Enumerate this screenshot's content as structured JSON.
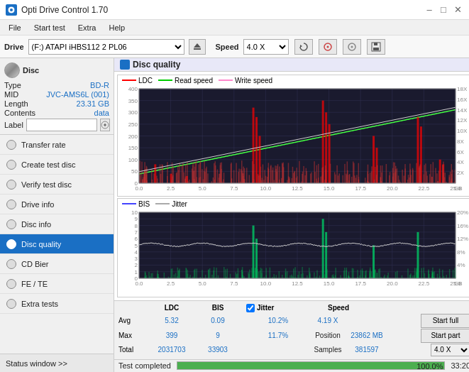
{
  "titlebar": {
    "title": "Opti Drive Control 1.70",
    "min_label": "–",
    "max_label": "□",
    "close_label": "✕"
  },
  "menubar": {
    "items": [
      "File",
      "Start test",
      "Extra",
      "Help"
    ]
  },
  "drivebar": {
    "drive_label": "Drive",
    "drive_value": "(F:)  ATAPI iHBS112  2 PL06",
    "speed_label": "Speed",
    "speed_value": "4.0 X"
  },
  "disc": {
    "label": "Disc",
    "type_label": "Type",
    "type_value": "BD-R",
    "mid_label": "MID",
    "mid_value": "JVC-AMS6L (001)",
    "length_label": "Length",
    "length_value": "23.31 GB",
    "contents_label": "Contents",
    "contents_value": "data",
    "label_label": "Label",
    "label_placeholder": ""
  },
  "nav": {
    "items": [
      {
        "id": "transfer-rate",
        "label": "Transfer rate",
        "active": false
      },
      {
        "id": "create-test-disc",
        "label": "Create test disc",
        "active": false
      },
      {
        "id": "verify-test-disc",
        "label": "Verify test disc",
        "active": false
      },
      {
        "id": "drive-info",
        "label": "Drive info",
        "active": false
      },
      {
        "id": "disc-info",
        "label": "Disc info",
        "active": false
      },
      {
        "id": "disc-quality",
        "label": "Disc quality",
        "active": true
      },
      {
        "id": "cd-bier",
        "label": "CD Bier",
        "active": false
      },
      {
        "id": "fe-te",
        "label": "FE / TE",
        "active": false
      },
      {
        "id": "extra-tests",
        "label": "Extra tests",
        "active": false
      }
    ]
  },
  "status_window": {
    "label": "Status window >>"
  },
  "chart": {
    "title": "Disc quality",
    "legend_top": [
      {
        "label": "LDC",
        "color": "red"
      },
      {
        "label": "Read speed",
        "color": "green"
      },
      {
        "label": "Write speed",
        "color": "pink"
      }
    ],
    "legend_bottom": [
      {
        "label": "BIS",
        "color": "blue"
      },
      {
        "label": "Jitter",
        "color": "white"
      }
    ],
    "top_y_left_max": 400,
    "top_y_right_max": 18,
    "top_x_max": 25.0,
    "bottom_y_left_max": 10,
    "bottom_y_right_max": 20,
    "bottom_x_max": 25.0
  },
  "stats": {
    "ldc_label": "LDC",
    "bis_label": "BIS",
    "jitter_label": "Jitter",
    "speed_label": "Speed",
    "avg_label": "Avg",
    "max_label": "Max",
    "total_label": "Total",
    "ldc_avg": "5.32",
    "ldc_max": "399",
    "ldc_total": "2031703",
    "bis_avg": "0.09",
    "bis_max": "9",
    "bis_total": "33903",
    "jitter_avg": "10.2%",
    "jitter_max": "11.7%",
    "jitter_total": "",
    "speed_value": "4.19 X",
    "speed_select": "4.0 X",
    "position_label": "Position",
    "position_value": "23862 MB",
    "samples_label": "Samples",
    "samples_value": "381597",
    "start_full_btn": "Start full",
    "start_part_btn": "Start part",
    "jitter_checked": true
  },
  "statusbar": {
    "status_text": "Test completed",
    "progress": 100.0,
    "time": "33:20"
  }
}
